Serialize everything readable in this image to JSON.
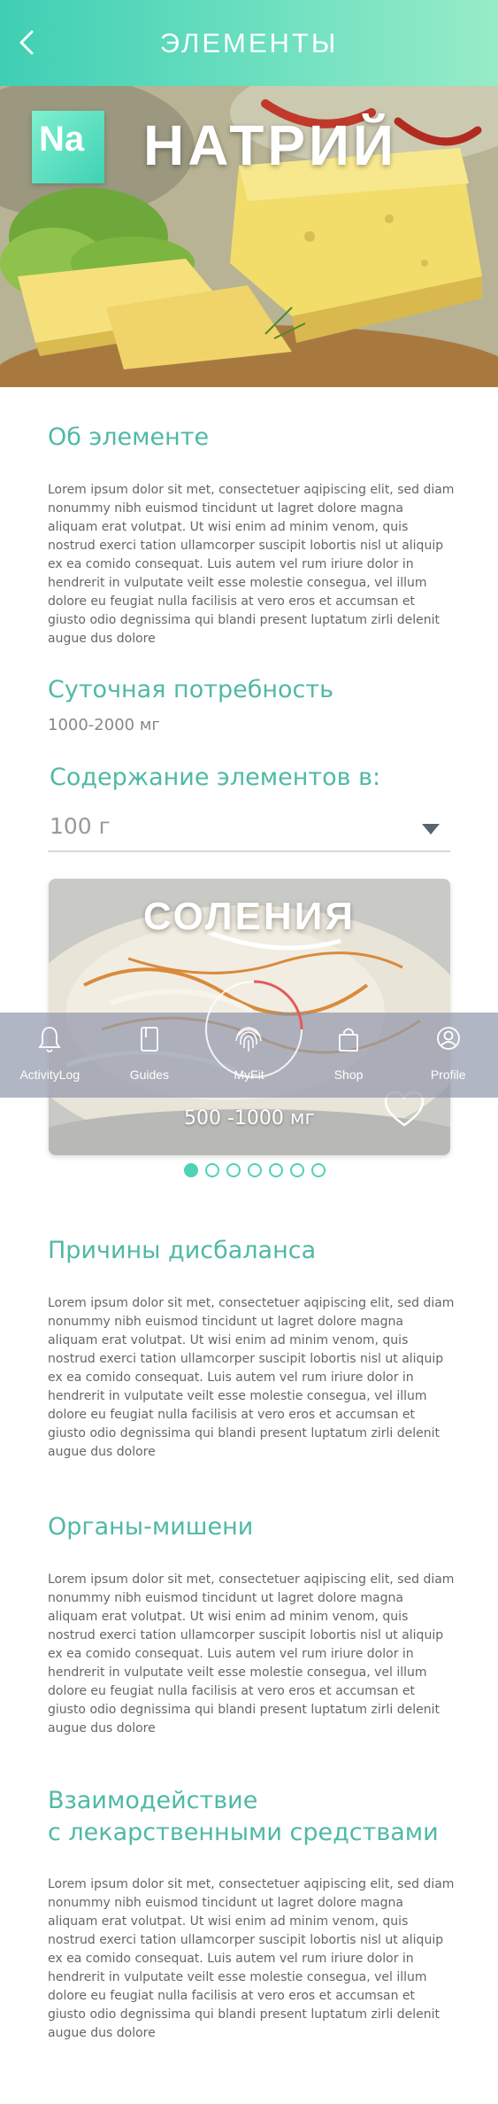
{
  "header": {
    "title": "ЭЛЕМЕНТЫ",
    "back_icon": "chevron-left-icon"
  },
  "hero": {
    "symbol": "Na",
    "name": "НАТРИЙ"
  },
  "about": {
    "title": "Об элементе",
    "text": "Lorem ipsum dolor sit met, consectetuer aqipiscing elit, sed diam nonummy nibh euismod tincidunt ut lagret dolore magna aliquam erat volutpat. Ut wisi enim ad minim venom, quis nostrud exerci tation ullamcorper suscipit lobortis nisl ut aliquip ex ea comido consequat. Luis autem vel rum iriure dolor in hendrerit in vulputate veilt esse molestie consegua, vel illum dolore eu feugiat nulla facilisis at vero eros et accumsan et giusto odio degnissima qui blandi present luptatum zirli delenit augue dus dolore"
  },
  "daily": {
    "title": "Суточная потребность",
    "value": "1000-2000 мг"
  },
  "content": {
    "title": "Содержание элементов в:",
    "selected": "100 г"
  },
  "card": {
    "title": "СОЛЕНИЯ",
    "amount": "500 -1000 мг",
    "heart_icon": "heart-outline-icon"
  },
  "carousel": {
    "count": 7,
    "active_index": 0
  },
  "imbalance": {
    "title": "Причины дисбаланса",
    "text": "Lorem ipsum dolor sit met, consectetuer aqipiscing elit, sed diam nonummy nibh euismod tincidunt ut lagret dolore magna aliquam erat volutpat. Ut wisi enim ad minim venom, quis nostrud exerci tation ullamcorper suscipit lobortis nisl ut aliquip ex ea comido consequat. Luis autem vel rum iriure dolor in hendrerit in vulputate veilt esse molestie consegua, vel illum dolore eu feugiat nulla facilisis at vero eros et accumsan et giusto odio degnissima qui blandi present luptatum zirli delenit augue dus dolore"
  },
  "organs": {
    "title": "Органы-мишени",
    "text": "Lorem ipsum dolor sit met, consectetuer aqipiscing elit, sed diam nonummy nibh euismod tincidunt ut lagret dolore magna aliquam erat volutpat. Ut wisi enim ad minim venom, quis nostrud exerci tation ullamcorper suscipit lobortis nisl ut aliquip ex ea comido consequat. Luis autem vel rum iriure dolor in hendrerit in vulputate veilt esse molestie consegua, vel illum dolore eu feugiat nulla facilisis at vero eros et accumsan et giusto odio degnissima qui blandi present luptatum zirli delenit augue dus dolore"
  },
  "interaction": {
    "title_line1": "Взаимодействие",
    "title_line2": "с лекарственными средствами",
    "text": "Lorem ipsum dolor sit met, consectetuer aqipiscing elit, sed diam nonummy nibh euismod tincidunt ut lagret dolore magna aliquam erat volutpat. Ut wisi enim ad minim venom, quis nostrud exerci tation ullamcorper suscipit lobortis nisl ut aliquip ex ea comido consequat. Luis autem vel rum iriure dolor in hendrerit in vulputate veilt esse molestie consegua, vel illum dolore eu feugiat nulla facilisis at vero eros et accumsan et giusto odio degnissima qui blandi present luptatum zirli delenit augue dus dolore"
  },
  "tabbar": {
    "tabs": [
      {
        "label": "ActivityLog",
        "icon": "bell-icon"
      },
      {
        "label": "Guides",
        "icon": "book-icon"
      },
      {
        "label": "MyFit",
        "icon": "fingerprint-icon"
      },
      {
        "label": "Shop",
        "icon": "shopping-bag-icon"
      },
      {
        "label": "Profile",
        "icon": "user-icon"
      }
    ]
  },
  "colors": {
    "accent": "#4fb9a5",
    "header_start": "#3fcfb4",
    "header_end": "#97ecc7",
    "ring_red": "#e35a5a"
  }
}
